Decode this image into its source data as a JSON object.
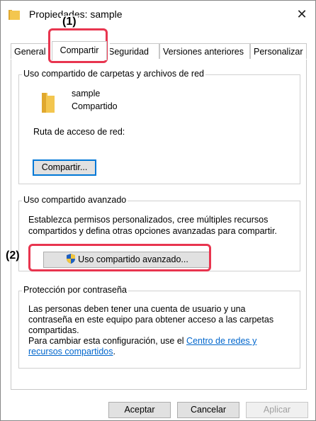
{
  "window": {
    "title": "Propiedades: sample",
    "close_label": "✕"
  },
  "tabs": [
    {
      "label": "General"
    },
    {
      "label": "Compartir"
    },
    {
      "label": "Seguridad"
    },
    {
      "label": "Versiones anteriores"
    },
    {
      "label": "Personalizar"
    }
  ],
  "network_share": {
    "group_title": "Uso compartido de carpetas y archivos de red",
    "folder_name": "sample",
    "folder_status": "Compartido",
    "path_label": "Ruta de acceso de red:",
    "share_button": "Compartir..."
  },
  "advanced_share": {
    "group_title": "Uso compartido avanzado",
    "description_line1": "Establezca permisos personalizados, cree múltiples recursos",
    "description_line2": "compartidos y defina otras opciones avanzadas para compartir.",
    "button": "Uso compartido avanzado..."
  },
  "password_protection": {
    "group_title": "Protección por contraseña",
    "line1": "Las personas deben tener una cuenta de usuario y una",
    "line2": "contraseña en este equipo para obtener acceso a las carpetas",
    "line3": "compartidas.",
    "line4_prefix": "Para cambiar esta configuración, use el ",
    "link_part1": "Centro de redes y",
    "link_part2": "recursos compartidos",
    "line5_suffix": "."
  },
  "footer": {
    "accept": "Aceptar",
    "cancel": "Cancelar",
    "apply": "Aplicar"
  },
  "annotations": {
    "callout1": "(1)",
    "callout2": "(2)"
  },
  "colors": {
    "highlight": "#e8354f",
    "folder": "#f3c64f",
    "link": "#0066cc",
    "focus": "#0078d7"
  }
}
